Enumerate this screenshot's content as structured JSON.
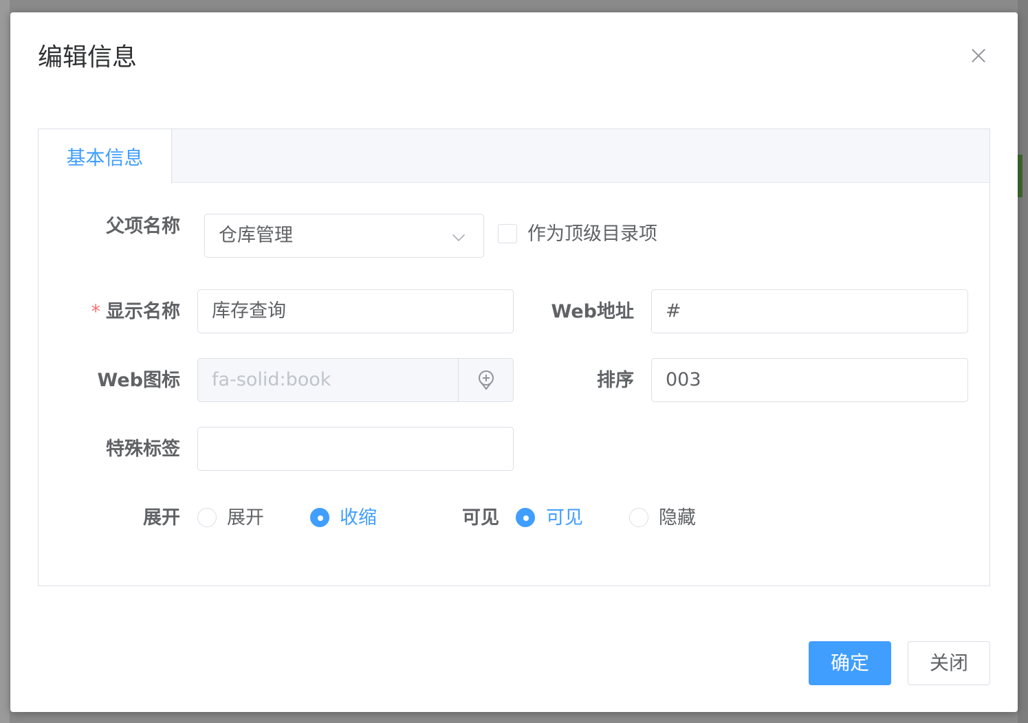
{
  "dialog": {
    "title": "编辑信息",
    "close_icon": "close-icon"
  },
  "tabs": [
    {
      "label": "基本信息",
      "active": true
    }
  ],
  "form": {
    "parent": {
      "label": "父项名称",
      "value": "仓库管理",
      "icon": "chevron-down-icon"
    },
    "top_level": {
      "label": "作为顶级目录项",
      "checked": false
    },
    "display_name": {
      "required_mark": "*",
      "label": "显示名称",
      "value": "库存查询"
    },
    "web_url": {
      "label": "Web地址",
      "value": "#"
    },
    "web_icon": {
      "label": "Web图标",
      "value": "fa-solid:book",
      "append_icon": "location-pin-icon"
    },
    "sort": {
      "label": "排序",
      "value": "003"
    },
    "special_tag": {
      "label": "特殊标签",
      "value": ""
    },
    "expand": {
      "label": "展开",
      "options": [
        {
          "label": "展开",
          "checked": false
        },
        {
          "label": "收缩",
          "checked": true
        }
      ]
    },
    "visible": {
      "label": "可见",
      "options": [
        {
          "label": "可见",
          "checked": true
        },
        {
          "label": "隐藏",
          "checked": false
        }
      ]
    }
  },
  "footer": {
    "confirm_label": "确定",
    "close_label": "关闭"
  },
  "colors": {
    "primary": "#409eff",
    "required": "#f56c6c"
  }
}
